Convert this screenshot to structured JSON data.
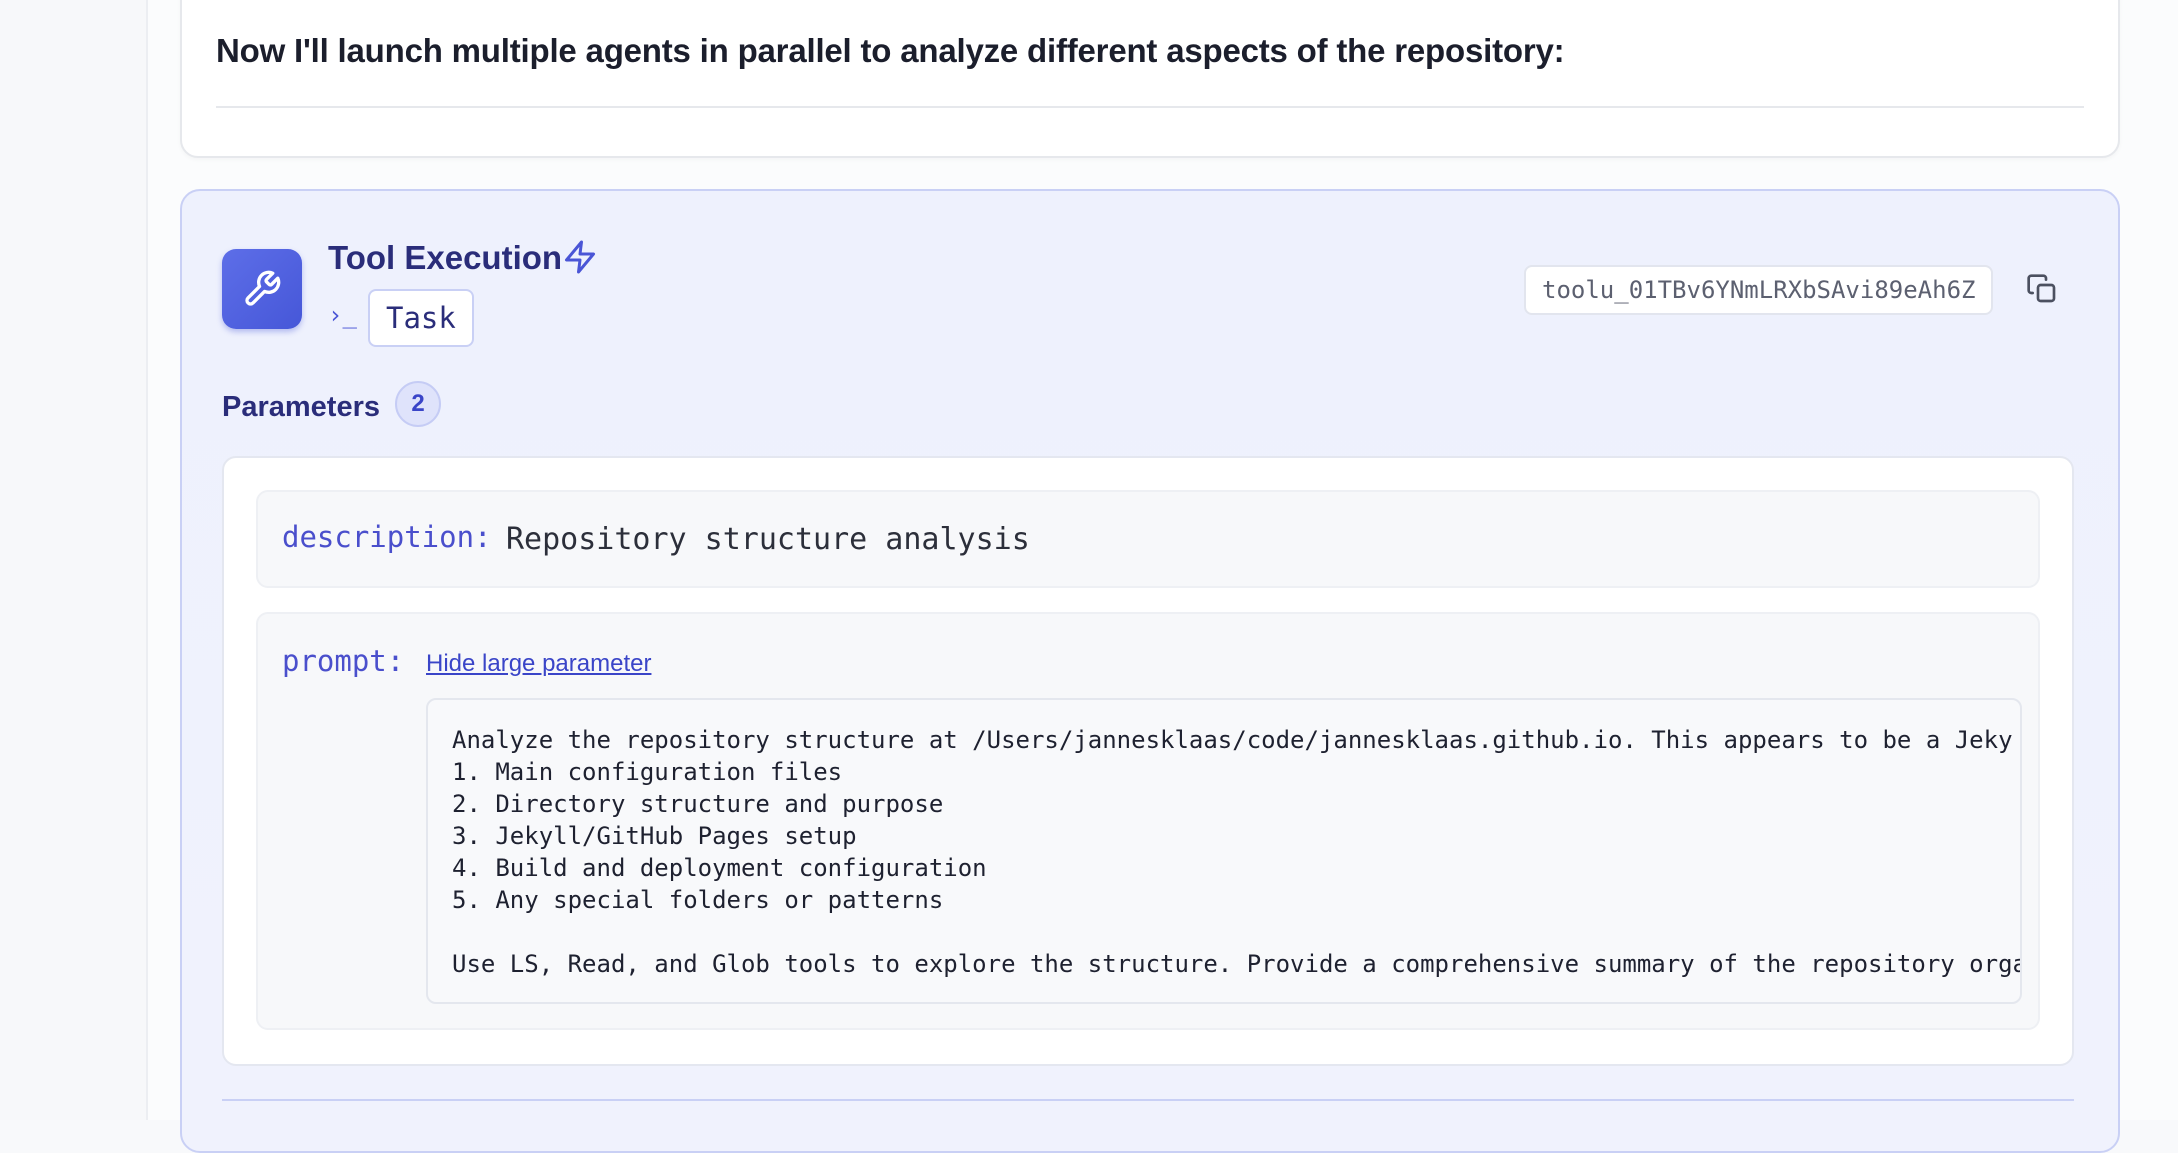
{
  "message": {
    "text": "Now I'll launch multiple agents in parallel to analyze different aspects of the repository:"
  },
  "tool": {
    "title": "Tool Execution",
    "title_icon": "bolt-icon",
    "header_icon": "wrench-icon",
    "command_icon": "terminal-prompt-icon",
    "command_glyph": "›_",
    "name": "Task",
    "id": "toolu_01TBv6YNmLRXbSAvi89eAh6Z",
    "copy_icon": "copy-icon",
    "accent_color": "#4a55d6"
  },
  "parameters": {
    "label": "Parameters",
    "count": "2",
    "items": [
      {
        "key": "description:",
        "value": "Repository structure analysis"
      },
      {
        "key": "prompt:",
        "toggle_label": "Hide large parameter",
        "value": "Analyze the repository structure at /Users/jannesklaas/code/jannesklaas.github.io. This appears to be a Jeky\n1. Main configuration files\n2. Directory structure and purpose\n3. Jekyll/GitHub Pages setup\n4. Build and deployment configuration\n5. Any special folders or patterns\n\nUse LS, Read, and Glob tools to explore the structure. Provide a comprehensive summary of the repository orga"
      }
    ]
  }
}
